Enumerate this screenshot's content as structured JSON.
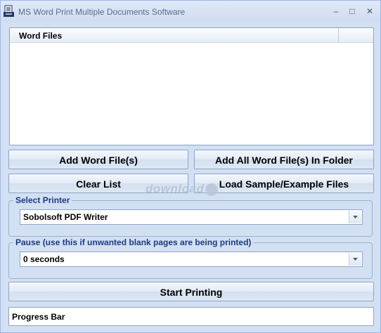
{
  "window": {
    "title": "MS Word Print Multiple Documents Software",
    "controls": {
      "minimize": "–",
      "maximize": "□",
      "close": "✕"
    }
  },
  "file_list": {
    "column_header": "Word Files",
    "rows": []
  },
  "buttons": {
    "add_files": "Add Word File(s)",
    "add_folder": "Add All Word File(s) In Folder",
    "clear_list": "Clear List",
    "load_sample": "Load Sample/Example Files",
    "start_printing": "Start Printing"
  },
  "printer_group": {
    "legend": "Select Printer",
    "selected": "Sobolsoft PDF Writer"
  },
  "pause_group": {
    "legend": "Pause (use this if unwanted blank pages are being printed)",
    "selected": "0 seconds"
  },
  "progress": {
    "label": "Progress Bar"
  },
  "watermark": {
    "text": "download"
  },
  "colors": {
    "window_bg": "#d3e0f3",
    "legend_text": "#1c3a80",
    "border": "#8ea4c6"
  }
}
